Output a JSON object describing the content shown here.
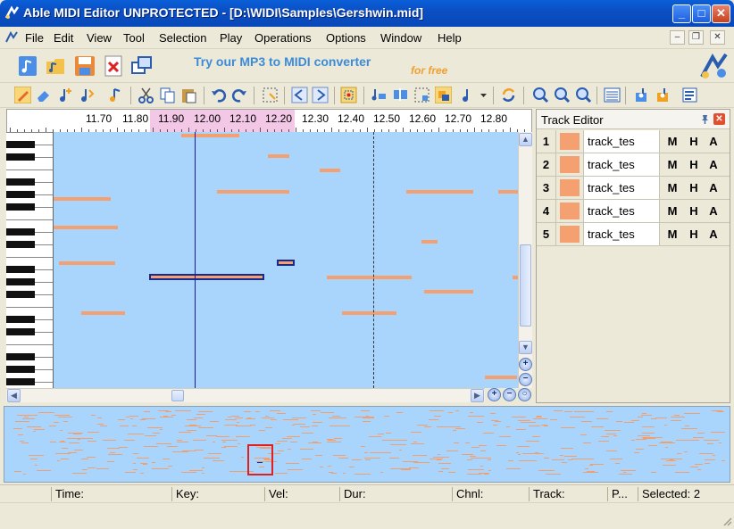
{
  "window": {
    "title": "Able MIDI Editor UNPROTECTED - [D:\\WIDI\\Samples\\Gershwin.mid]",
    "minimize": "_",
    "maximize": "□",
    "close": "✕"
  },
  "menu": {
    "items": [
      "File",
      "Edit",
      "View",
      "Tool",
      "Selection",
      "Play",
      "Operations",
      "Options",
      "Window",
      "Help"
    ],
    "mdi_minimize": "–",
    "mdi_restore": "❐",
    "mdi_close": "✕"
  },
  "promo": {
    "text": "Try our MP3 to MIDI converter",
    "subtext": "for free"
  },
  "ruler": {
    "labels": [
      "11.70",
      "11.80",
      "11.90",
      "12.00",
      "12.10",
      "12.20",
      "12.30",
      "12.40",
      "12.50",
      "12.60",
      "12.70",
      "12.80"
    ]
  },
  "track_editor": {
    "title": "Track Editor",
    "pin": "📌",
    "close": "✕",
    "tracks": [
      {
        "num": "1",
        "name": "track_tes",
        "m": "M",
        "h": "H",
        "a": "A",
        "color": "#f5a070"
      },
      {
        "num": "2",
        "name": "track_tes",
        "m": "M",
        "h": "H",
        "a": "A",
        "color": "#f5a070"
      },
      {
        "num": "3",
        "name": "track_tes",
        "m": "M",
        "h": "H",
        "a": "A",
        "color": "#f5a070"
      },
      {
        "num": "4",
        "name": "track_tes",
        "m": "M",
        "h": "H",
        "a": "A",
        "color": "#f5a070"
      },
      {
        "num": "5",
        "name": "track_tes",
        "m": "M",
        "h": "H",
        "a": "A",
        "color": "#f5a070"
      }
    ]
  },
  "status": {
    "time": "Time:",
    "key": "Key:",
    "vel": "Vel:",
    "dur": "Dur:",
    "chnl": "Chnl:",
    "track": "Track:",
    "p": "P...",
    "selected": "Selected: 2"
  },
  "colors": {
    "note": "#f5a070",
    "grid_bg": "#a9d4fc",
    "selected_border": "#1a2a8a",
    "ruler_selection": "#f3c8e6"
  },
  "scroll": {
    "up": "▲",
    "down": "▼",
    "left": "◀",
    "right": "▶",
    "zoom_in": "+",
    "zoom_out": "−",
    "zoom_fit": "○"
  }
}
